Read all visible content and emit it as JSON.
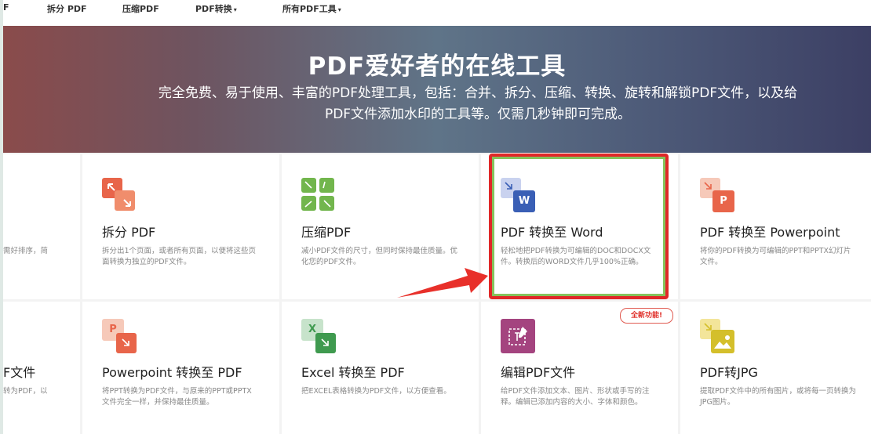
{
  "nav": {
    "items": [
      {
        "label": "F",
        "caret": false
      },
      {
        "label": "拆分 PDF",
        "caret": false
      },
      {
        "label": "压缩PDF",
        "caret": false
      },
      {
        "label": "PDF转换",
        "caret": true
      },
      {
        "label": "所有PDF工具",
        "caret": true
      }
    ],
    "caret_glyph": "▾"
  },
  "hero": {
    "title": "PDF爱好者的在线工具",
    "subtitle": "完全免费、易于使用、丰富的PDF处理工具，包括：合并、拆分、压缩、转换、旋转和解锁PDF文件，以及给PDF文件添加水印的工具等。仅需几秒钟即可完成。"
  },
  "tools": [
    {
      "id": "merge",
      "title": "",
      "desc": "需好排序，简",
      "icon": "merge-icon"
    },
    {
      "id": "split",
      "title": "拆分 PDF",
      "desc": "拆分出1个页面，或者所有页面，以便将这些页面转换为独立的PDF文件。",
      "icon": "split-icon",
      "color": "#e8654a"
    },
    {
      "id": "compress",
      "title": "压缩PDF",
      "desc": "减小PDF文件的尺寸，但同时保持最佳质量。优化您的PDF文件。",
      "icon": "compress-icon",
      "color": "#72b64d"
    },
    {
      "id": "pdf-to-word",
      "title": "PDF 转换至 Word",
      "desc": "轻松地把PDF转换为可编辑的DOC和DOCX文件。转换后的WORD文件几乎100%正确。",
      "icon": "word-icon",
      "letter": "W",
      "color": "#3a5fb5"
    },
    {
      "id": "pdf-to-ppt",
      "title": "PDF 转换至 Powerpoint",
      "desc": "将你的PDF转换为可编辑的PPT和PPTX幻灯片文件。",
      "icon": "powerpoint-icon",
      "letter": "P",
      "color": "#e8654a"
    },
    {
      "id": "word-to-pdf",
      "title": "F文件",
      "desc": "转为PDF，以",
      "icon": "word-to-pdf-icon"
    },
    {
      "id": "ppt-to-pdf",
      "title": "Powerpoint 转换至 PDF",
      "desc": "将PPT转换为PDF文件，与原来的PPT或PPTX文件完全一样，并保持最佳质量。",
      "icon": "ppt-to-pdf-icon",
      "letter": "P",
      "color": "#e8654a"
    },
    {
      "id": "excel-to-pdf",
      "title": "Excel 转换至 PDF",
      "desc": "把EXCEL表格转换为PDF文件，以方便查看。",
      "icon": "excel-icon",
      "letter": "X",
      "color": "#3f9a4f"
    },
    {
      "id": "edit-pdf",
      "title": "编辑PDF文件",
      "desc": "给PDF文件添加文本、图片、形状或手写的注释。编辑已添加内容的大小、字体和颜色。",
      "icon": "edit-icon",
      "color": "#a4447f"
    },
    {
      "id": "pdf-to-jpg",
      "title": "PDF转JPG",
      "desc": "提取PDF文件中的所有图片，或将每一页转换为JPG图片。",
      "icon": "jpg-icon",
      "color": "#d4bf2b"
    }
  ],
  "badge": {
    "label": "全新功能!"
  },
  "colors": {
    "highlight_border": "#e02828",
    "highlight_inner": "#86c35b",
    "arrow": "#e8302a",
    "hero_start": "#8a4b4b",
    "hero_end": "#3c3f64"
  }
}
